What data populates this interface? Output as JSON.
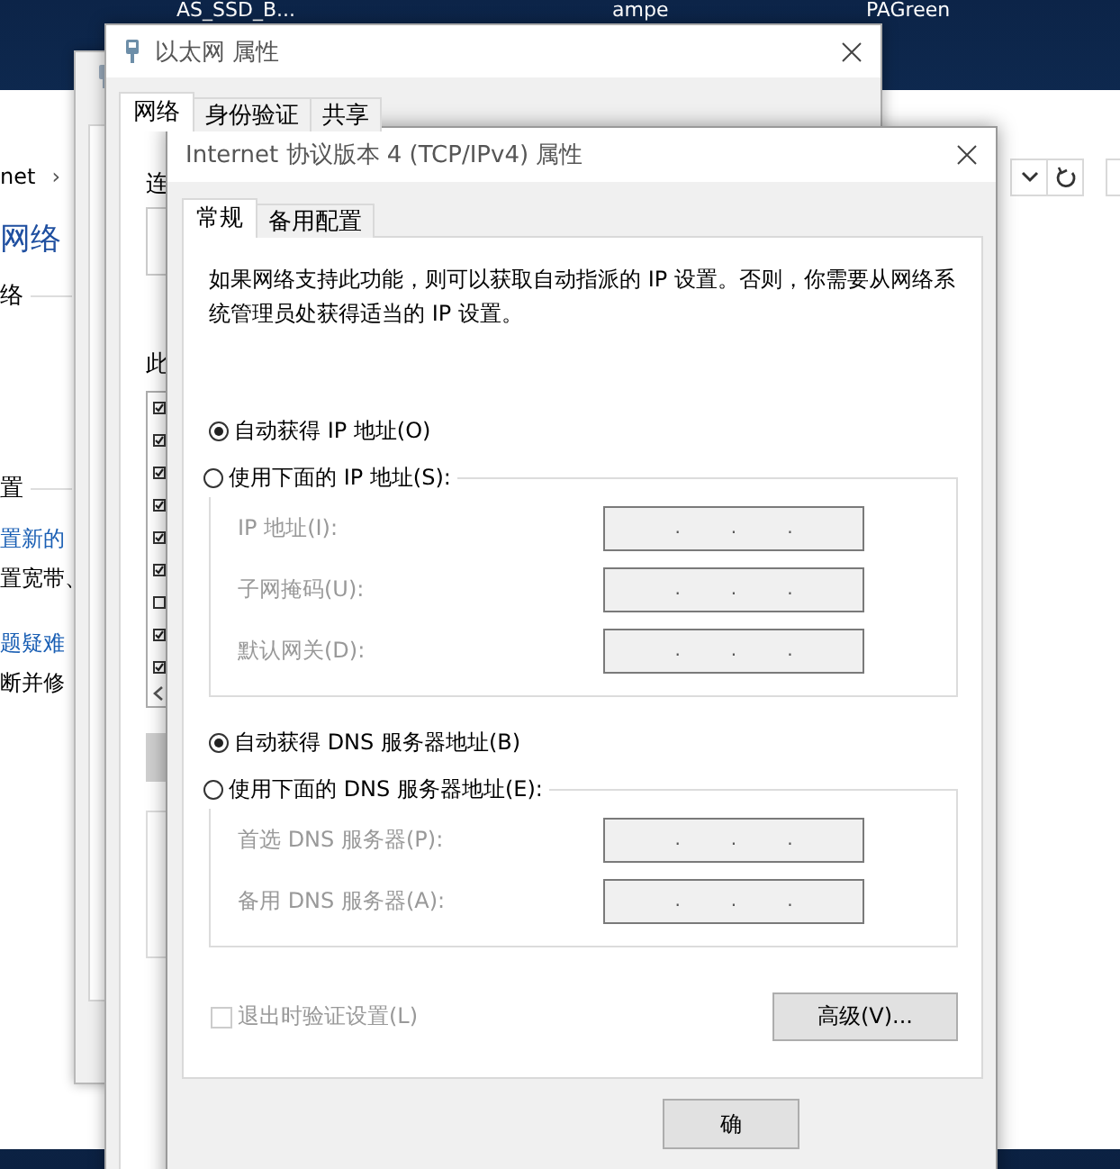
{
  "desktop": {
    "icons": [
      {
        "label": "AS_SSD_B..."
      },
      {
        "label": "ampe"
      },
      {
        "label": "PAGreen"
      }
    ]
  },
  "explorer": {
    "breadcrumb": "net",
    "breadcrumb_arrow": "›",
    "sidebar": [
      {
        "text": "网络",
        "kind": "heading"
      },
      {
        "text": "络",
        "kind": "section"
      },
      {
        "text": "置",
        "kind": "section"
      },
      {
        "text": "置新的",
        "kind": "link"
      },
      {
        "text": "置宽带、",
        "kind": "text"
      },
      {
        "text": "题疑难",
        "kind": "link"
      },
      {
        "text": "断并修",
        "kind": "text"
      }
    ]
  },
  "ethernet_dialog": {
    "title": "以太网 属性",
    "tabs": [
      {
        "label": "网络",
        "selected": true
      },
      {
        "label": "身份验证",
        "selected": false
      },
      {
        "label": "共享",
        "selected": false
      }
    ],
    "connect_label": "连",
    "items_label": "此",
    "items": [
      {
        "checked": true
      },
      {
        "checked": true
      },
      {
        "checked": true
      },
      {
        "checked": true
      },
      {
        "checked": true
      },
      {
        "checked": true
      },
      {
        "checked": false
      },
      {
        "checked": true
      },
      {
        "checked": true
      }
    ]
  },
  "ipv4_dialog": {
    "title": "Internet 协议版本 4 (TCP/IPv4) 属性",
    "tabs": [
      {
        "label": "常规",
        "selected": true
      },
      {
        "label": "备用配置",
        "selected": false
      }
    ],
    "description": "如果网络支持此功能，则可以获取自动指派的 IP 设置。否则，你需要从网络系统管理员处获得适当的 IP 设置。",
    "groups": [
      {
        "auto_option": {
          "label": "自动获得 IP 地址(O)",
          "selected": true
        },
        "manual_option": {
          "label": "使用下面的 IP 地址(S):",
          "selected": false
        },
        "fields": [
          {
            "label": "IP 地址(I):",
            "separators": [
              ".",
              ".",
              "."
            ],
            "disabled": true
          },
          {
            "label": "子网掩码(U):",
            "separators": [
              ".",
              ".",
              "."
            ],
            "disabled": true
          },
          {
            "label": "默认网关(D):",
            "separators": [
              ".",
              ".",
              "."
            ],
            "disabled": true
          }
        ]
      },
      {
        "auto_option": {
          "label": "自动获得 DNS 服务器地址(B)",
          "selected": true
        },
        "manual_option": {
          "label": "使用下面的 DNS 服务器地址(E):",
          "selected": false
        },
        "fields": [
          {
            "label": "首选 DNS 服务器(P):",
            "separators": [
              ".",
              ".",
              "."
            ],
            "disabled": true
          },
          {
            "label": "备用 DNS 服务器(A):",
            "separators": [
              ".",
              ".",
              "."
            ],
            "disabled": true
          }
        ]
      }
    ],
    "validate_checkbox": {
      "label": "退出时验证设置(L)",
      "checked": false,
      "disabled": true
    },
    "advanced_button": "高级(V)...",
    "ok_button": "确"
  }
}
